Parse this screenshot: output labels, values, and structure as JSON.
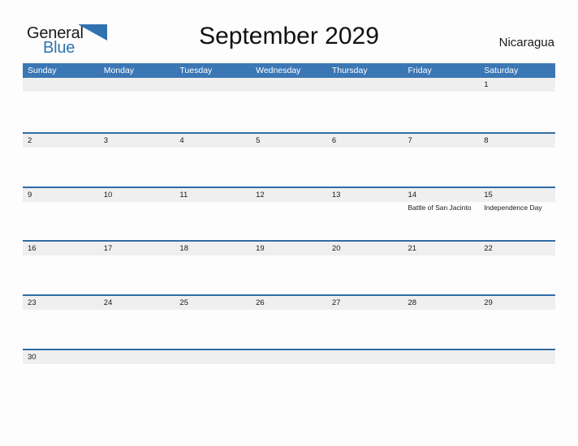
{
  "brand": {
    "name_dark": "General",
    "name_blue": "Blue",
    "flag_icon": "blue-triangle-flag-icon",
    "dark_color": "#1a1a1a",
    "blue_color": "#2f72b0"
  },
  "header": {
    "title": "September 2029",
    "country": "Nicaragua"
  },
  "theme": {
    "header_blue": "#3b77b5",
    "row_rule_blue": "#2e6da4",
    "band_gray": "#efefef",
    "page_background": "#fdfdfd",
    "text_color": "#1a1a1a"
  },
  "weekday_headers": [
    "Sunday",
    "Monday",
    "Tuesday",
    "Wednesday",
    "Thursday",
    "Friday",
    "Saturday"
  ],
  "weeks": [
    [
      {
        "day": "",
        "events": []
      },
      {
        "day": "",
        "events": []
      },
      {
        "day": "",
        "events": []
      },
      {
        "day": "",
        "events": []
      },
      {
        "day": "",
        "events": []
      },
      {
        "day": "",
        "events": []
      },
      {
        "day": "1",
        "events": []
      }
    ],
    [
      {
        "day": "2",
        "events": []
      },
      {
        "day": "3",
        "events": []
      },
      {
        "day": "4",
        "events": []
      },
      {
        "day": "5",
        "events": []
      },
      {
        "day": "6",
        "events": []
      },
      {
        "day": "7",
        "events": []
      },
      {
        "day": "8",
        "events": []
      }
    ],
    [
      {
        "day": "9",
        "events": []
      },
      {
        "day": "10",
        "events": []
      },
      {
        "day": "11",
        "events": []
      },
      {
        "day": "12",
        "events": []
      },
      {
        "day": "13",
        "events": []
      },
      {
        "day": "14",
        "events": [
          "Battle of San Jacinto"
        ]
      },
      {
        "day": "15",
        "events": [
          "Independence Day"
        ]
      }
    ],
    [
      {
        "day": "16",
        "events": []
      },
      {
        "day": "17",
        "events": []
      },
      {
        "day": "18",
        "events": []
      },
      {
        "day": "19",
        "events": []
      },
      {
        "day": "20",
        "events": []
      },
      {
        "day": "21",
        "events": []
      },
      {
        "day": "22",
        "events": []
      }
    ],
    [
      {
        "day": "23",
        "events": []
      },
      {
        "day": "24",
        "events": []
      },
      {
        "day": "25",
        "events": []
      },
      {
        "day": "26",
        "events": []
      },
      {
        "day": "27",
        "events": []
      },
      {
        "day": "28",
        "events": []
      },
      {
        "day": "29",
        "events": []
      }
    ],
    [
      {
        "day": "30",
        "events": []
      },
      {
        "day": "",
        "events": []
      },
      {
        "day": "",
        "events": []
      },
      {
        "day": "",
        "events": []
      },
      {
        "day": "",
        "events": []
      },
      {
        "day": "",
        "events": []
      },
      {
        "day": "",
        "events": []
      }
    ]
  ]
}
